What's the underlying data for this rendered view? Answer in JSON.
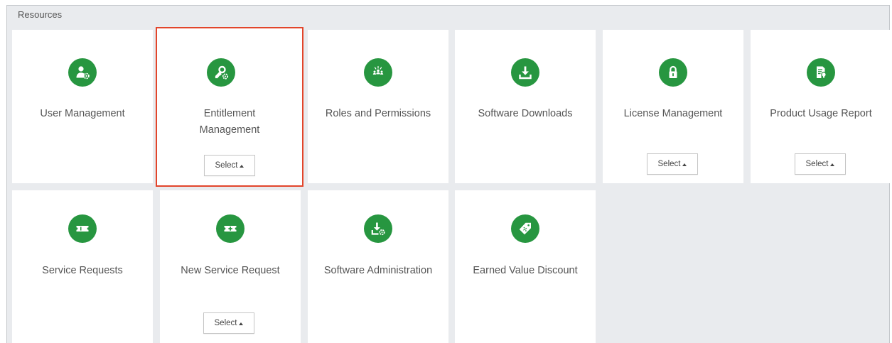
{
  "panel": {
    "title": "Resources"
  },
  "accent_color": "#279640",
  "highlight_color": "#e2452b",
  "tiles": [
    {
      "label": "User Management",
      "icon": "user-gear-icon",
      "has_select": false
    },
    {
      "label": "Entitlement Management",
      "icon": "key-gear-icon",
      "has_select": true,
      "select_label": "Select",
      "highlighted": true
    },
    {
      "label": "Roles and Permissions",
      "icon": "people-group-icon",
      "has_select": false
    },
    {
      "label": "Software Downloads",
      "icon": "download-tray-icon",
      "has_select": false
    },
    {
      "label": "License Management",
      "icon": "padlock-icon",
      "has_select": true,
      "select_label": "Select"
    },
    {
      "label": "Product Usage Report",
      "icon": "report-bulb-icon",
      "has_select": true,
      "select_label": "Select"
    },
    {
      "label": "Service Requests",
      "icon": "ticket-icon",
      "has_select": false
    },
    {
      "label": "New Service Request",
      "icon": "ticket-plus-icon",
      "has_select": true,
      "select_label": "Select"
    },
    {
      "label": "Software Administration",
      "icon": "download-gear-icon",
      "has_select": false
    },
    {
      "label": "Earned Value Discount",
      "icon": "discount-tag-icon",
      "has_select": false
    }
  ]
}
